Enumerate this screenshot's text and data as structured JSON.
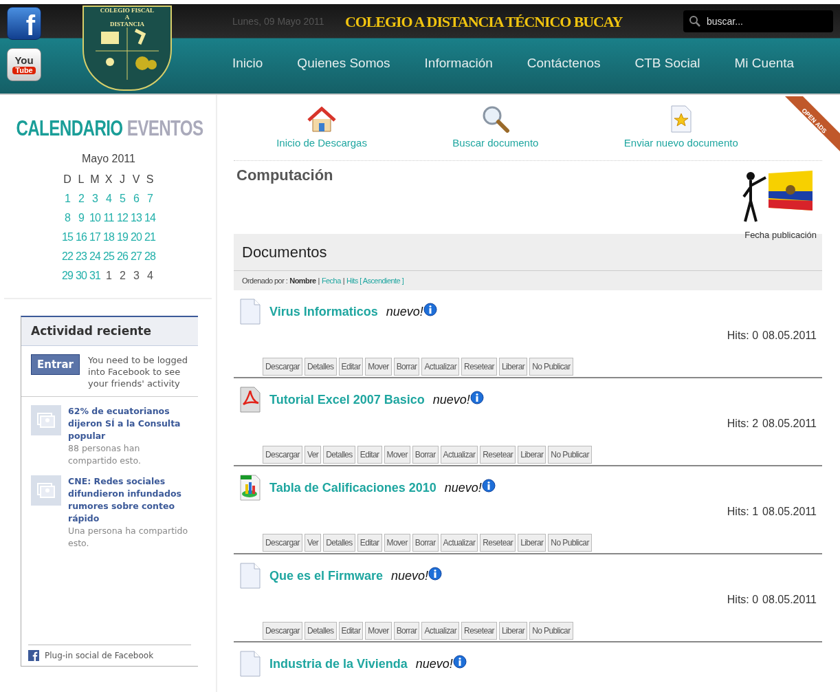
{
  "header": {
    "social": [
      {
        "kind": "facebook",
        "label": "f"
      },
      {
        "kind": "youtube",
        "label": "You",
        "label2": "Tube"
      }
    ],
    "crest": {
      "line1": "COLEGIO FISCAL",
      "line2": "A",
      "line3": "DISTANCIA"
    },
    "date": "Lunes, 09 Mayo 2011",
    "title": "COLEGIO A DISTANCIA TÉCNICO BUCAY",
    "search": {
      "placeholder": "buscar..."
    },
    "nav": [
      {
        "label": "Inicio"
      },
      {
        "label": "Quienes Somos"
      },
      {
        "label": "Información"
      },
      {
        "label": "Contáctenos"
      },
      {
        "label": "CTB Social"
      },
      {
        "label": "Mi Cuenta"
      }
    ]
  },
  "calendar": {
    "title_a": "CALENDARIO",
    "title_b": "EVENTOS",
    "month": "Mayo 2011",
    "weekdays": [
      "D",
      "L",
      "M",
      "X",
      "J",
      "V",
      "S"
    ],
    "weeks": [
      [
        {
          "day": "1",
          "other_month": false
        },
        {
          "day": "2",
          "other_month": false
        },
        {
          "day": "3",
          "other_month": false
        },
        {
          "day": "4",
          "other_month": false
        },
        {
          "day": "5",
          "other_month": false
        },
        {
          "day": "6",
          "other_month": false
        },
        {
          "day": "7",
          "other_month": false
        }
      ],
      [
        {
          "day": "8",
          "other_month": false
        },
        {
          "day": "9",
          "other_month": false
        },
        {
          "day": "10",
          "other_month": false
        },
        {
          "day": "11",
          "other_month": false
        },
        {
          "day": "12",
          "other_month": false
        },
        {
          "day": "13",
          "other_month": false
        },
        {
          "day": "14",
          "other_month": false
        }
      ],
      [
        {
          "day": "15",
          "other_month": false
        },
        {
          "day": "16",
          "other_month": false
        },
        {
          "day": "17",
          "other_month": false
        },
        {
          "day": "18",
          "other_month": false
        },
        {
          "day": "19",
          "other_month": false
        },
        {
          "day": "20",
          "other_month": false
        },
        {
          "day": "21",
          "other_month": false
        }
      ],
      [
        {
          "day": "22",
          "other_month": false
        },
        {
          "day": "23",
          "other_month": false
        },
        {
          "day": "24",
          "other_month": false
        },
        {
          "day": "25",
          "other_month": false
        },
        {
          "day": "26",
          "other_month": false
        },
        {
          "day": "27",
          "other_month": false
        },
        {
          "day": "28",
          "other_month": false
        }
      ],
      [
        {
          "day": "29",
          "other_month": false
        },
        {
          "day": "30",
          "other_month": false
        },
        {
          "day": "31",
          "other_month": false
        },
        {
          "day": "1",
          "other_month": true
        },
        {
          "day": "2",
          "other_month": true
        },
        {
          "day": "3",
          "other_month": true
        },
        {
          "day": "4",
          "other_month": true
        }
      ]
    ]
  },
  "facebook_widget": {
    "title": "Actividad reciente",
    "login_button": "Entrar",
    "login_text": "You need to be logged into Facebook to see your friends' activity",
    "stories": [
      {
        "headline": "62% de ecuatorianos dijeron SÍ a la Consulta popular",
        "shares": "88 personas han compartido esto."
      },
      {
        "headline": "CNE: Redes sociales difundieron infundados rumores sobre conteo rápido",
        "shares": "Una persona ha compartido esto."
      }
    ],
    "footer": "Plug-in social de Facebook"
  },
  "toolbar": [
    {
      "kind": "home",
      "label": "Inicio de Descargas"
    },
    {
      "kind": "search",
      "label": "Buscar documento"
    },
    {
      "kind": "upload",
      "label": "Enviar nuevo documento"
    }
  ],
  "ribbon": "OPEN ADS",
  "category": {
    "title": "Computación",
    "image_caption": "Fecha publicación"
  },
  "documents": {
    "title": "Documentos",
    "sort_label": "Ordenado por :",
    "sort_separator": "|",
    "sort_options": [
      {
        "label": "Nombre",
        "selected": true
      },
      {
        "label": "Fecha",
        "selected": false
      },
      {
        "label": "Hits [ Ascendiente ]",
        "selected": false
      }
    ],
    "items": [
      {
        "kind": "generic",
        "name": "Virus Informaticos",
        "badge": "nuevo!",
        "hits": "Hits: 0",
        "date": "08.05.2011",
        "actions": [
          "Descargar",
          "Detalles",
          "Editar",
          "Mover",
          "Borrar",
          "Actualizar",
          "Resetear",
          "Liberar",
          "No Publicar"
        ]
      },
      {
        "kind": "pdf",
        "name": "Tutorial Excel 2007 Basico",
        "badge": "nuevo!",
        "hits": "Hits: 2",
        "date": "08.05.2011",
        "actions": [
          "Descargar",
          "Ver",
          "Detalles",
          "Editar",
          "Mover",
          "Borrar",
          "Actualizar",
          "Resetear",
          "Liberar",
          "No Publicar"
        ]
      },
      {
        "kind": "xls",
        "name": "Tabla de Calificaciones 2010",
        "badge": "nuevo!",
        "hits": "Hits: 1",
        "date": "08.05.2011",
        "actions": [
          "Descargar",
          "Ver",
          "Detalles",
          "Editar",
          "Mover",
          "Borrar",
          "Actualizar",
          "Resetear",
          "Liberar",
          "No Publicar"
        ]
      },
      {
        "kind": "generic",
        "name": "Que es el Firmware",
        "badge": "nuevo!",
        "hits": "Hits: 0",
        "date": "08.05.2011",
        "actions": [
          "Descargar",
          "Detalles",
          "Editar",
          "Mover",
          "Borrar",
          "Actualizar",
          "Resetear",
          "Liberar",
          "No Publicar"
        ]
      },
      {
        "kind": "generic",
        "name": "Industria de la Vivienda",
        "badge": "nuevo!"
      }
    ]
  }
}
